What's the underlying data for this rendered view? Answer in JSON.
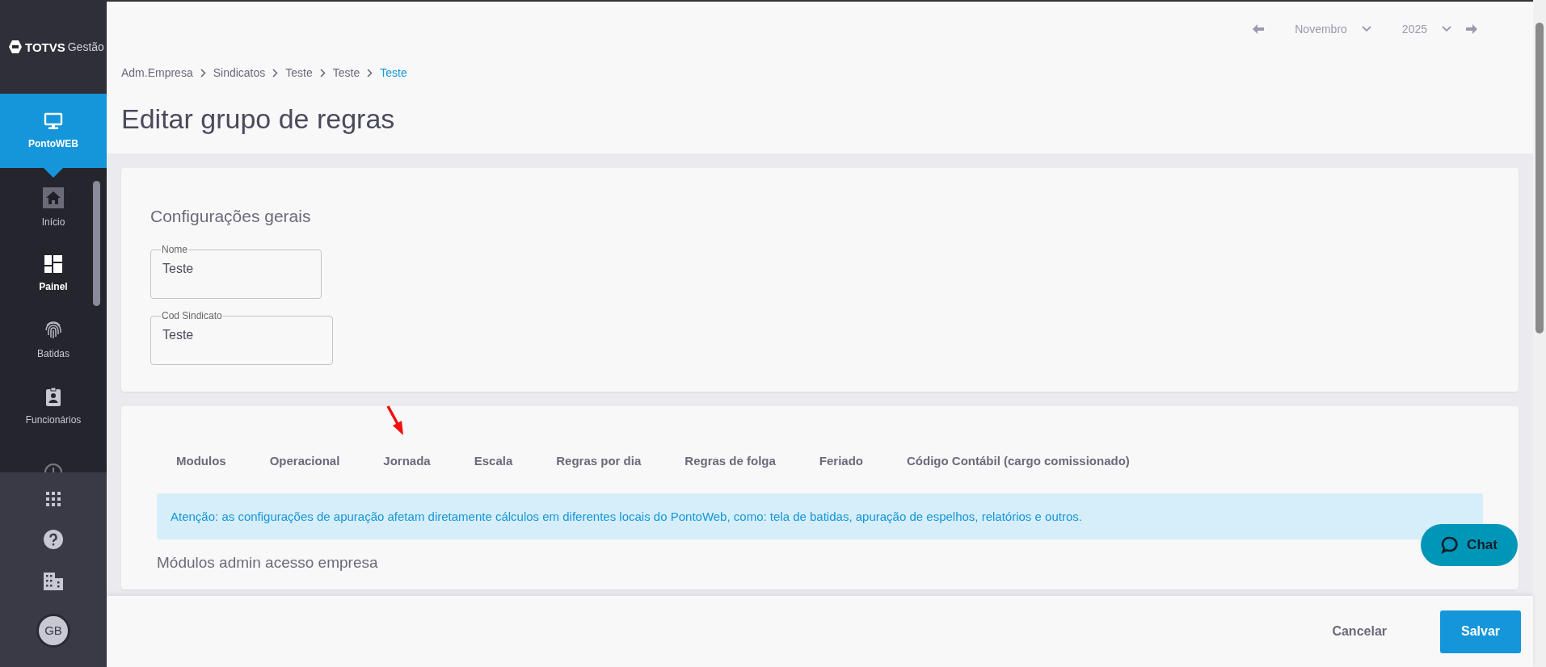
{
  "sidebar": {
    "logo": {
      "brand": "TOTVS",
      "product": "Gestão"
    },
    "module": {
      "label": "PontoWEB",
      "selected": true
    },
    "items": [
      {
        "label": "Início",
        "kind": "home",
        "selected": false
      },
      {
        "label": "Painel",
        "kind": "dashboard",
        "selected": true
      },
      {
        "label": "Batidas",
        "kind": "fingerprint",
        "selected": false
      },
      {
        "label": "Funcionários",
        "kind": "badge",
        "selected": false
      },
      {
        "kind": "clock",
        "selected": false
      }
    ],
    "avatar": "GB"
  },
  "period": {
    "month": "Novembro",
    "year": "2025"
  },
  "breadcrumb": [
    {
      "label": "Adm.Empresa",
      "current": false
    },
    {
      "label": "Sindicatos",
      "current": false
    },
    {
      "label": "Teste",
      "current": false
    },
    {
      "label": "Teste",
      "current": false
    },
    {
      "label": "Teste",
      "current": true
    }
  ],
  "title": "Editar grupo de regras",
  "general": {
    "heading": "Configurações gerais",
    "fields": [
      {
        "label": "Nome",
        "value": "Teste"
      },
      {
        "label": "Cod Sindicato",
        "value": "Teste"
      }
    ]
  },
  "tabs": [
    {
      "label": "Modulos"
    },
    {
      "label": "Operacional"
    },
    {
      "label": "Jornada"
    },
    {
      "label": "Escala"
    },
    {
      "label": "Regras por dia"
    },
    {
      "label": "Regras de folga"
    },
    {
      "label": "Feriado"
    },
    {
      "label": "Código Contábil (cargo comissionado)"
    }
  ],
  "alert": "Atenção: as configurações de apuração afetam diretamente cálculos em diferentes locais do PontoWeb, como: tela de batidas, apuração de espelhos, relatórios e outros.",
  "section_heading": "Módulos admin acesso empresa",
  "chat": "Chat",
  "footer": {
    "cancel": "Cancelar",
    "save": "Salvar"
  }
}
